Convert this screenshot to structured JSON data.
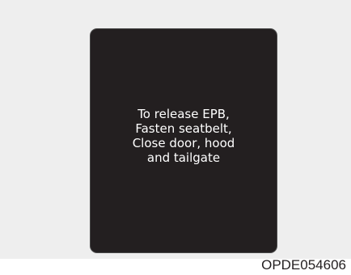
{
  "display": {
    "message_lines": [
      "To release EPB,",
      "Fasten seatbelt,",
      "Close door, hood",
      "and tailgate"
    ],
    "colors": {
      "background": "#eeeeee",
      "screen": "#231f20",
      "text": "#ffffff"
    }
  },
  "figure_code": "OPDE054606"
}
